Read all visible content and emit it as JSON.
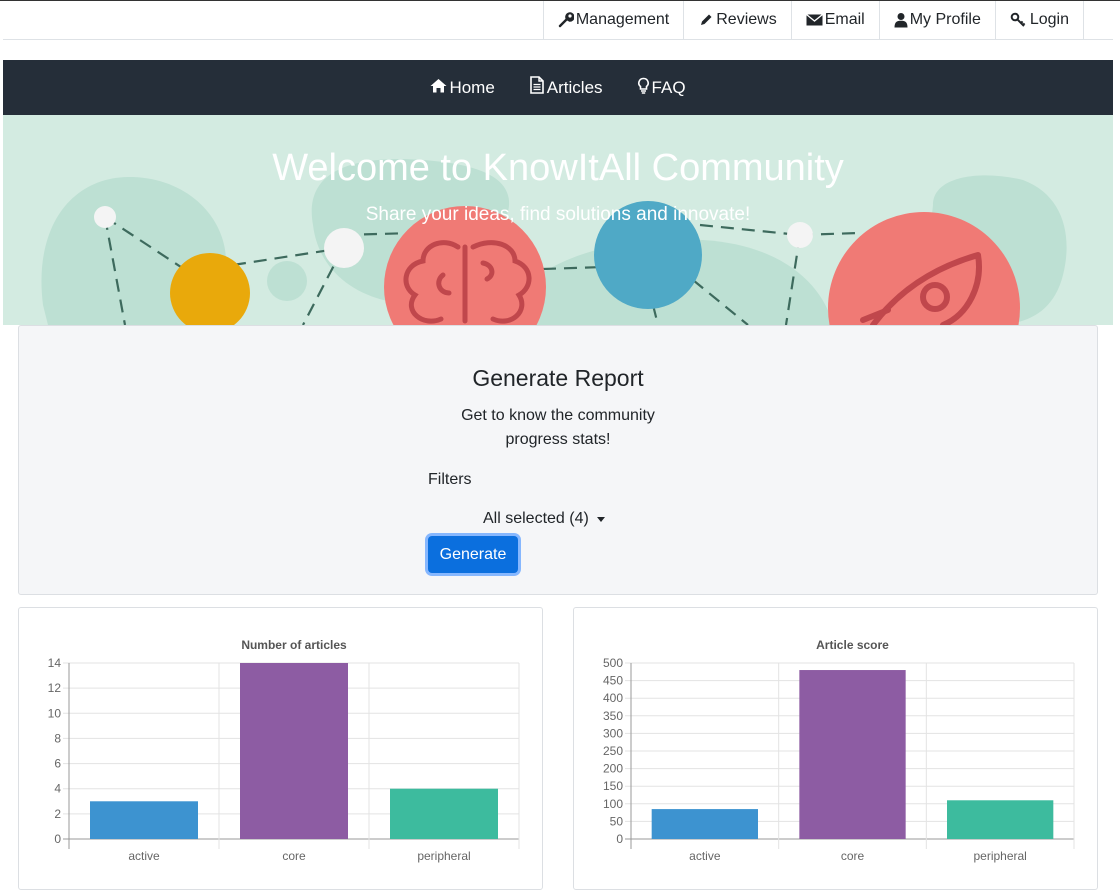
{
  "top_nav": [
    {
      "label": "Management",
      "icon": "wrench-icon"
    },
    {
      "label": "Reviews",
      "icon": "pencil-icon"
    },
    {
      "label": "Email",
      "icon": "envelope-icon"
    },
    {
      "label": "My Profile",
      "icon": "user-icon"
    },
    {
      "label": "Login",
      "icon": "key-icon"
    }
  ],
  "main_nav": [
    {
      "label": "Home",
      "icon": "home-icon"
    },
    {
      "label": "Articles",
      "icon": "document-icon"
    },
    {
      "label": "FAQ",
      "icon": "lightbulb-icon"
    }
  ],
  "hero": {
    "title": "Welcome to KnowItAll Community",
    "subtitle": "Share your ideas, find solutions and innovate!"
  },
  "report": {
    "title": "Generate Report",
    "description": "Get to know the community progress stats!",
    "filters_label": "Filters",
    "filter_value": "All selected (4)",
    "generate_label": "Generate"
  },
  "colors": {
    "nav_bg": "#252e39",
    "hero_bg": "#d3ebe1",
    "button": "#0b6fde",
    "active": "#3d93d0",
    "core": "#8d5ca3",
    "peripheral": "#3dbb9e"
  },
  "chart_data": [
    {
      "type": "bar",
      "title": "Number of articles",
      "categories": [
        "active",
        "core",
        "peripheral"
      ],
      "values": [
        3,
        14,
        4
      ],
      "ylim": [
        0,
        14
      ],
      "yticks": [
        0,
        2,
        4,
        6,
        8,
        10,
        12,
        14
      ],
      "grid": true
    },
    {
      "type": "bar",
      "title": "Article score",
      "categories": [
        "active",
        "core",
        "peripheral"
      ],
      "values": [
        85,
        480,
        110
      ],
      "ylim": [
        0,
        500
      ],
      "yticks": [
        0,
        50,
        100,
        150,
        200,
        250,
        300,
        350,
        400,
        450,
        500
      ],
      "grid": true
    }
  ]
}
